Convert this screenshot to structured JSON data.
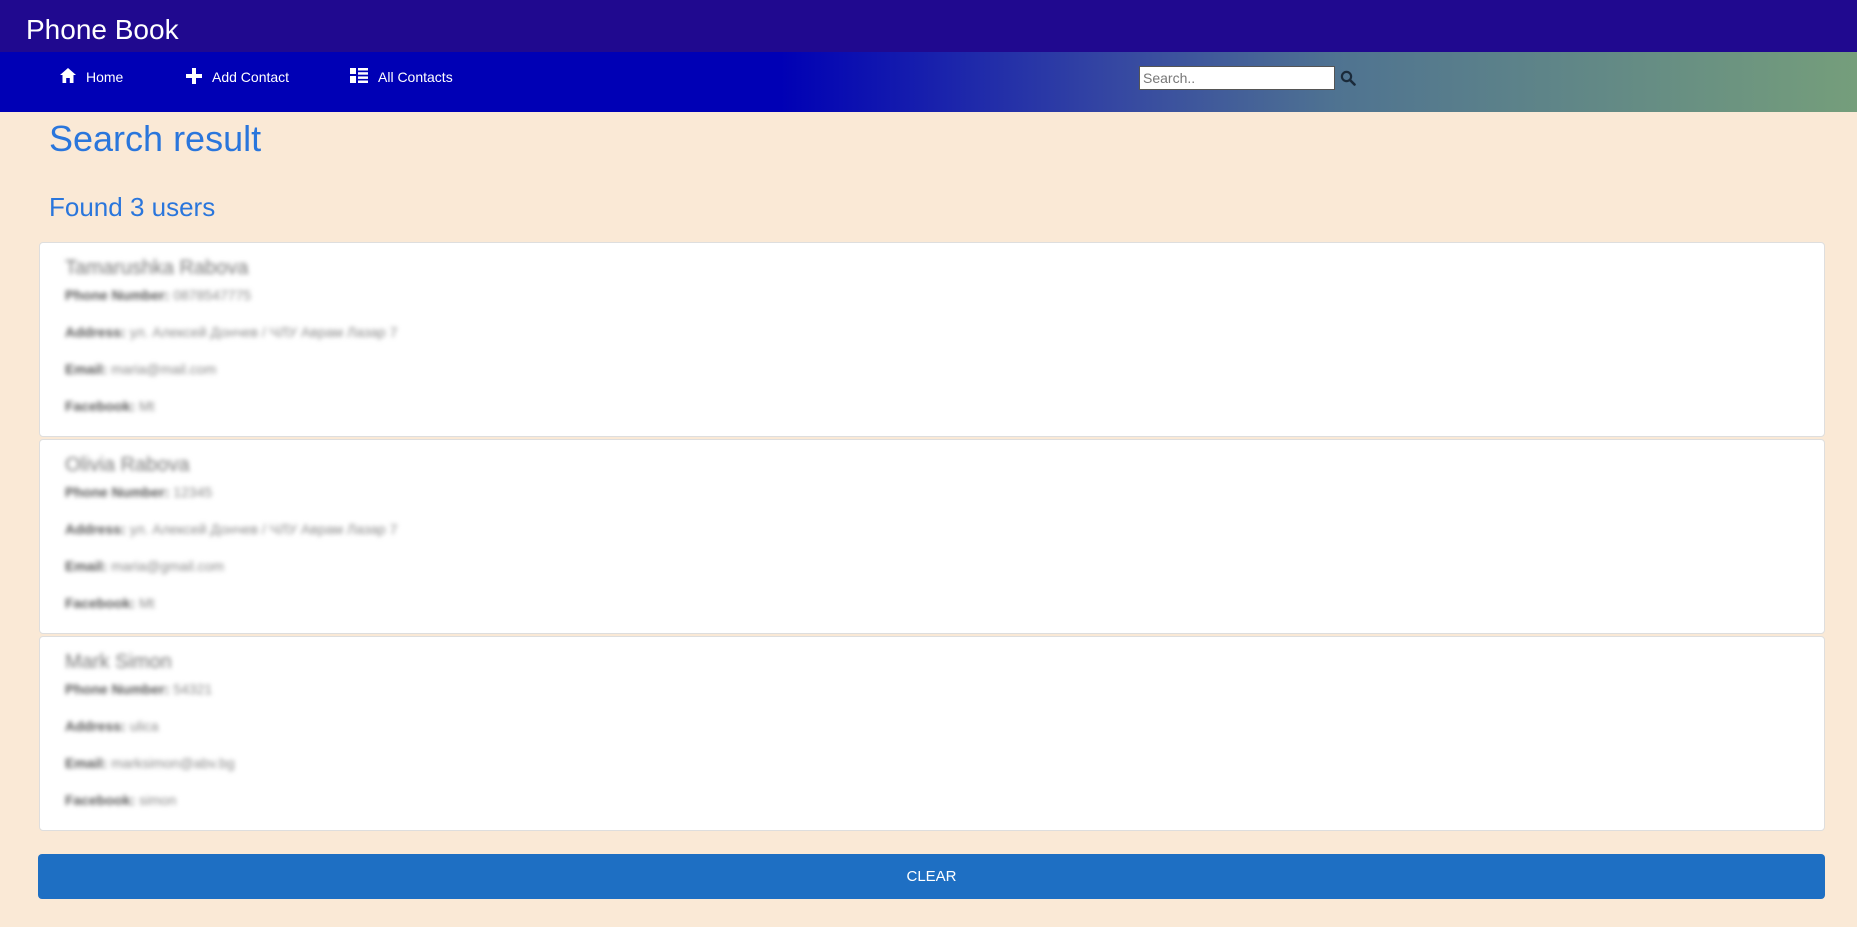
{
  "app": {
    "title": "Phone Book"
  },
  "nav": {
    "items": [
      {
        "label": "Home",
        "icon": "home-icon"
      },
      {
        "label": "Add Contact",
        "icon": "plus-icon"
      },
      {
        "label": "All Contacts",
        "icon": "list-icon"
      }
    ]
  },
  "search": {
    "placeholder": "Search..",
    "value": ""
  },
  "main": {
    "title": "Search result",
    "found": "Found 3 users"
  },
  "field_labels": {
    "phone": "Phone Number:",
    "address": "Address:",
    "email": "Email:",
    "facebook": "Facebook:"
  },
  "contacts": [
    {
      "name": "Tamarushka Rabova",
      "phone": "0878547775",
      "address": "ул. Алексей Дончев / ЧЛУ Аврам Лазар 7",
      "email": "maria@mail.com",
      "facebook": "Mt"
    },
    {
      "name": "Olivia Rabova",
      "phone": "12345",
      "address": "ул. Алексей Дончев / ЧЛУ Аврам Лазар 7",
      "email": "maria@gmail.com",
      "facebook": "Mt"
    },
    {
      "name": "Mark Simon",
      "phone": "54321",
      "address": "ulica",
      "email": "marksimon@abv.bg",
      "facebook": "simon"
    }
  ],
  "actions": {
    "clear_label": "CLEAR"
  },
  "colors": {
    "header": "#20098f",
    "nav_start": "#0000b5",
    "nav_end": "#759e7b",
    "accent": "#2a76dc",
    "button": "#1e6fc3",
    "background": "#fae9d6"
  }
}
